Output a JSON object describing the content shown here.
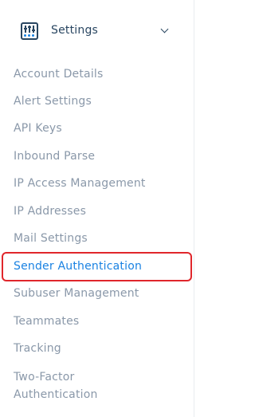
{
  "sidebar": {
    "section": {
      "title": "Settings",
      "icon": "settings-sliders-icon",
      "chevron_icon": "chevron-down-icon"
    },
    "items": [
      {
        "label": "Account Details"
      },
      {
        "label": "Alert Settings"
      },
      {
        "label": "API Keys"
      },
      {
        "label": "Inbound Parse"
      },
      {
        "label": "IP Access Management"
      },
      {
        "label": "IP Addresses"
      },
      {
        "label": "Mail Settings"
      },
      {
        "label": "Sender Authentication",
        "active": true
      },
      {
        "label": "Subuser Management"
      },
      {
        "label": "Teammates"
      },
      {
        "label": "Tracking"
      },
      {
        "label": "Two-Factor Authentication"
      }
    ]
  },
  "colors": {
    "section_text": "#294661",
    "item_text": "#8a98a9",
    "active_text": "#1a82e2",
    "highlight_border": "#e0262b"
  }
}
